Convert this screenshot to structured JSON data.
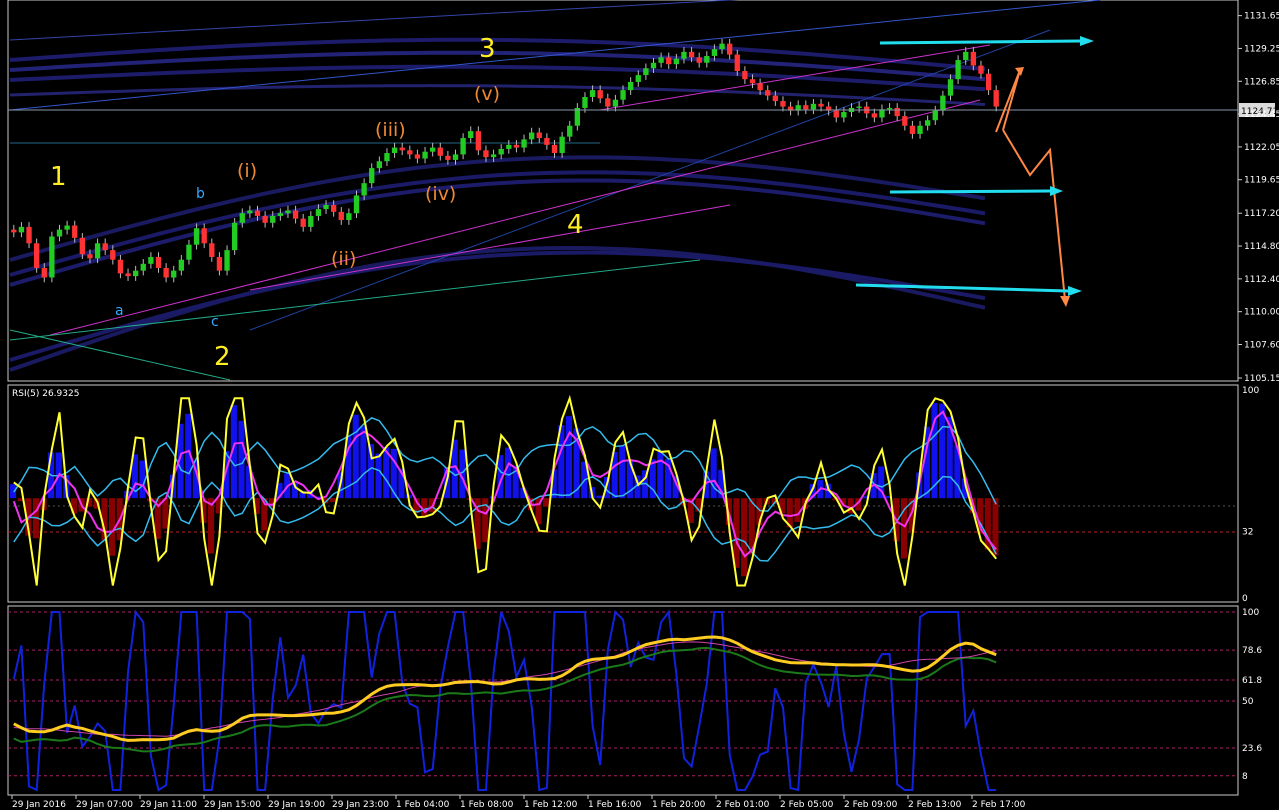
{
  "chart_data": [
    {
      "panel": "main-price",
      "type": "candlestick",
      "symbol_current_price": "1124.71",
      "y_ticks": [
        "1131.65",
        "1129.25",
        "1126.85",
        "1124.45",
        "1122.05",
        "1119.65",
        "1117.20",
        "1114.80",
        "1112.40",
        "1110.00",
        "1107.60",
        "1105.15"
      ],
      "ylim": [
        1105.15,
        1132.5
      ],
      "candles_close": [
        1115.8,
        1116.2,
        1115.0,
        1113.2,
        1112.5,
        1115.5,
        1116.0,
        1116.3,
        1115.4,
        1114.2,
        1113.9,
        1115.0,
        1114.5,
        1113.8,
        1112.8,
        1112.6,
        1113.0,
        1113.5,
        1114.0,
        1113.2,
        1112.5,
        1113.0,
        1113.8,
        1114.9,
        1116.1,
        1115.0,
        1114.0,
        1113.0,
        1114.5,
        1116.5,
        1117.2,
        1117.4,
        1117.0,
        1116.5,
        1117.0,
        1117.2,
        1117.4,
        1116.8,
        1116.2,
        1117.0,
        1117.5,
        1117.8,
        1117.3,
        1116.7,
        1117.2,
        1118.5,
        1119.4,
        1120.5,
        1121.0,
        1121.6,
        1122.0,
        1121.8,
        1121.5,
        1121.2,
        1121.7,
        1122.0,
        1121.4,
        1121.1,
        1121.5,
        1122.7,
        1123.2,
        1121.8,
        1121.3,
        1121.5,
        1121.9,
        1122.2,
        1122.0,
        1122.6,
        1123.1,
        1122.7,
        1122.2,
        1121.6,
        1122.8,
        1123.6,
        1124.9,
        1125.7,
        1126.2,
        1125.6,
        1125.0,
        1125.5,
        1126.2,
        1126.8,
        1127.3,
        1127.8,
        1128.2,
        1128.6,
        1128.1,
        1128.5,
        1129.0,
        1128.6,
        1128.2,
        1128.7,
        1129.2,
        1129.6,
        1128.8,
        1127.6,
        1127.0,
        1126.7,
        1126.2,
        1125.8,
        1125.4,
        1125.0,
        1124.7,
        1125.1,
        1124.8,
        1125.2,
        1125.0,
        1124.7,
        1124.2,
        1124.6,
        1124.9,
        1125.0,
        1124.5,
        1124.2,
        1124.8,
        1124.9,
        1124.3,
        1123.6,
        1123.0,
        1123.6,
        1124.0,
        1124.7,
        1125.8,
        1127.0,
        1128.4,
        1129.0,
        1128.0,
        1127.4,
        1126.2,
        1125.0
      ]
    },
    {
      "panel": "rsi",
      "type": "line",
      "title": "RSI(5) 26.9325",
      "y_ticks": [
        "100",
        "32",
        "0"
      ],
      "ylim": [
        0,
        100
      ]
    },
    {
      "panel": "stochastic",
      "type": "line",
      "y_ticks": [
        "100",
        "78.6",
        "61.8",
        "50",
        "23.6",
        "8"
      ],
      "ylim": [
        0,
        100
      ]
    }
  ],
  "x_axis": {
    "labels": [
      "29 Jan 2016",
      "29 Jan 07:00",
      "29 Jan 11:00",
      "29 Jan 15:00",
      "29 Jan 19:00",
      "29 Jan 23:00",
      "1 Feb 04:00",
      "1 Feb 08:00",
      "1 Feb 12:00",
      "1 Feb 16:00",
      "1 Feb 20:00",
      "2 Feb 01:00",
      "2 Feb 05:00",
      "2 Feb 09:00",
      "2 Feb 13:00",
      "2 Feb 17:00"
    ]
  },
  "annotations": {
    "wave_1": "1",
    "wave_2": "2",
    "wave_3": "3",
    "wave_4": "4",
    "sub_i": "(i)",
    "sub_ii": "(ii)",
    "sub_iii": "(iii)",
    "sub_iv": "(iv)",
    "sub_v": "(v)",
    "corr_a": "a",
    "corr_b": "b",
    "corr_c": "c"
  },
  "colors": {
    "background": "#000000",
    "bull_candle": "#22cc22",
    "bear_candle": "#ff3333",
    "wave_major": "#ffee22",
    "wave_minor": "#ee8833",
    "corrective": "#33aaff",
    "forecast_arrow": "#ff8844",
    "target_arrow": "#22ddee",
    "rsi_line": "#ffff33",
    "rsi_pos_hist": "#1111ee",
    "rsi_neg_hist": "#880000",
    "stoch_main": "#ffcc22",
    "stoch_fast": "#1122dd",
    "stoch_slow": "#1a7a1a"
  }
}
